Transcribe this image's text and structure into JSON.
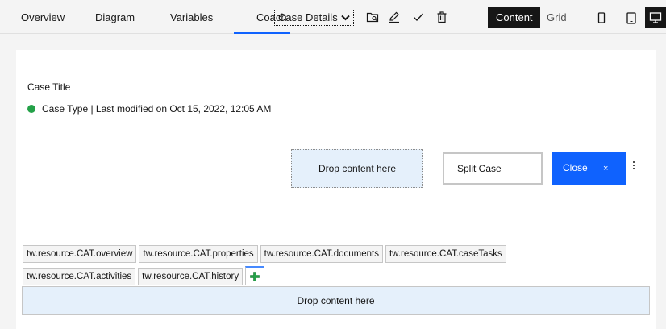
{
  "topnav": {
    "tabs": [
      {
        "label": "Overview"
      },
      {
        "label": "Diagram"
      },
      {
        "label": "Variables"
      },
      {
        "label": "Coach"
      }
    ],
    "coach_select": "Case Details",
    "view_toggle": {
      "content": "Content",
      "grid": "Grid"
    }
  },
  "canvas": {
    "case_title": "Case Title",
    "case_meta": "Case Type | Last modified on Oct 15, 2022, 12:05 AM",
    "drop_top": "Drop content here",
    "split_label": "Split Case",
    "close_label": "Close",
    "close_x": "×",
    "tabs_row1": [
      "tw.resource.CAT.overview",
      "tw.resource.CAT.properties",
      "tw.resource.CAT.documents",
      "tw.resource.CAT.caseTasks"
    ],
    "tabs_row2": [
      "tw.resource.CAT.activities",
      "tw.resource.CAT.history"
    ],
    "drop_bottom": "Drop content here"
  },
  "colors": {
    "accent": "#0f62fe",
    "status": "#24a148",
    "drop_bg": "#e5f0fb",
    "add_icon": "#24a148"
  }
}
